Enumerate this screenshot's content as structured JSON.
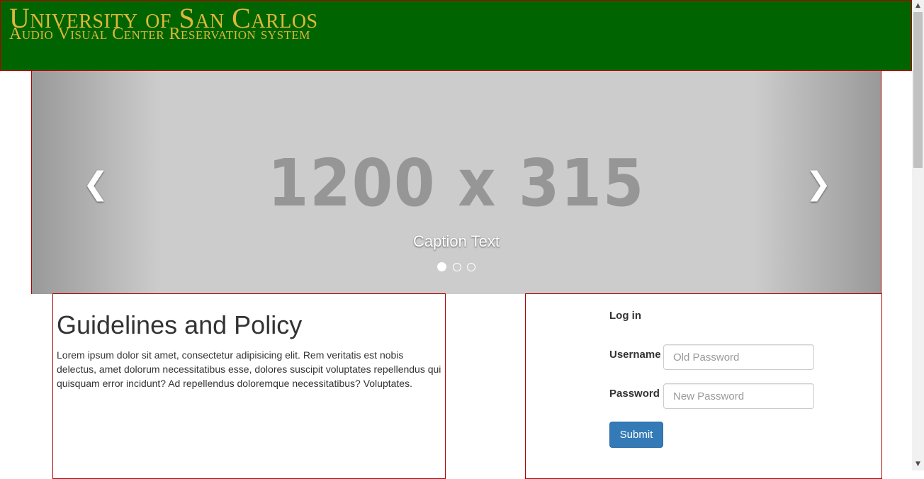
{
  "header": {
    "title": "University of San Carlos",
    "subtitle": "Audio Visual Center Reservation system",
    "bg_color": "#006400",
    "text_color": "#e0b73a"
  },
  "carousel": {
    "placeholder_text": "1200 x 315",
    "caption": "Caption Text",
    "prev_icon": "chevron-left-icon",
    "next_icon": "chevron-right-icon",
    "prev_glyph": "❮",
    "next_glyph": "❯",
    "slides": 3,
    "active_slide": 1
  },
  "guidelines": {
    "heading": "Guidelines and Policy",
    "body": "Lorem ipsum dolor sit amet, consectetur adipisicing elit. Rem veritatis est nobis delectus, amet dolorum necessitatibus esse, dolores suscipit voluptates repellendus qui quisquam error incidunt? Ad repellendus doloremque necessitatibus? Voluptates."
  },
  "login": {
    "title": "Log in",
    "username_label": "Username",
    "username_placeholder": "Old Password",
    "username_value": "",
    "password_label": "Password",
    "password_placeholder": "New Password",
    "password_value": "",
    "submit_label": "Submit",
    "button_color": "#337ab7"
  },
  "scrollbar": {
    "up_glyph": "▲",
    "down_glyph": "▼"
  }
}
